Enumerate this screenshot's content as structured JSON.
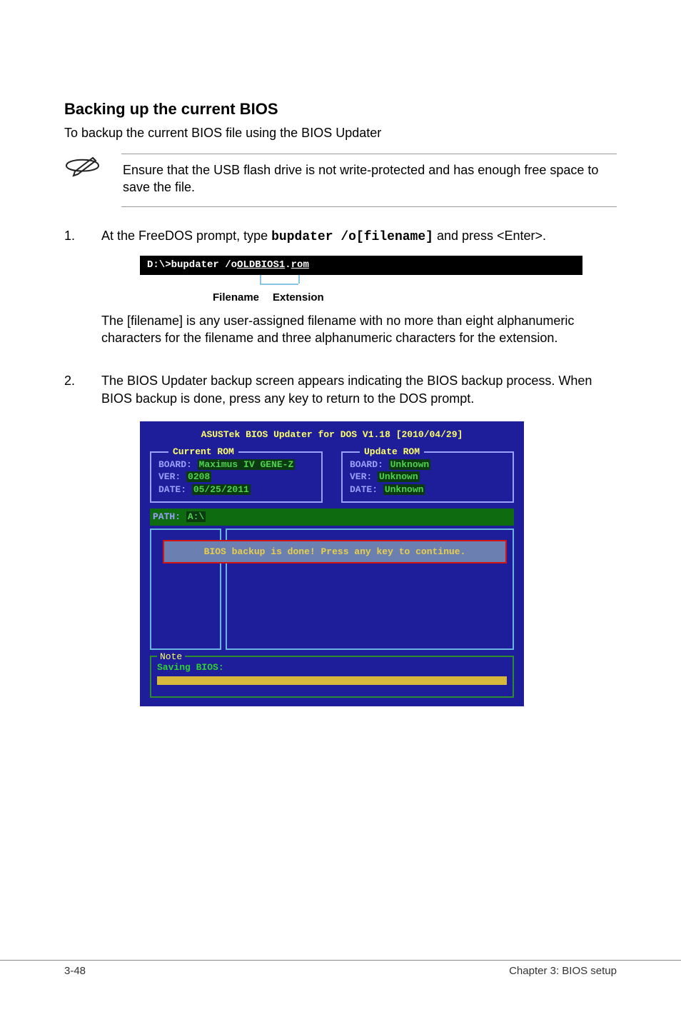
{
  "heading": "Backing up the current BIOS",
  "intro": "To backup the current BIOS file using the BIOS Updater",
  "note": "Ensure that the USB flash drive is not write-protected and has enough free space to save the file.",
  "step1": {
    "num": "1.",
    "prefix": "At the FreeDOS prompt, type ",
    "cmd": "bupdater /o[filename]",
    "suffix": " and press <Enter>."
  },
  "terminal": {
    "text_pre": "D:\\>bupdater /o",
    "file_base": "OLDBIOS1",
    "dot": ".",
    "file_ext": "rom",
    "label_filename": "Filename",
    "label_extension": "Extension"
  },
  "step1_sub": "The [filename] is any user-assigned filename with no more than eight alphanumeric characters for the filename and three alphanumeric characters for the extension.",
  "step2": {
    "num": "2.",
    "text": "The BIOS Updater backup screen appears indicating the BIOS backup process. When BIOS backup is done, press any key to return to the DOS prompt."
  },
  "bios": {
    "title": "ASUSTek BIOS Updater for DOS V1.18 [2010/04/29]",
    "current": {
      "legend": "Current ROM",
      "board_label": "BOARD:",
      "board_val": "Maximus IV GENE-Z",
      "ver_label": "VER:",
      "ver_val": "0208",
      "date_label": "DATE:",
      "date_val": "05/25/2011"
    },
    "update": {
      "legend": "Update ROM",
      "board_label": "BOARD:",
      "board_val": "Unknown",
      "ver_label": "VER:",
      "ver_val": "Unknown",
      "date_label": "DATE:",
      "date_val": "Unknown"
    },
    "path_label": "PATH:",
    "path_val": "A:\\",
    "banner": "BIOS backup is done! Press any key to continue.",
    "note_legend": "Note",
    "saving": "Saving BIOS:"
  },
  "footer": {
    "left": "3-48",
    "right": "Chapter 3: BIOS setup"
  }
}
